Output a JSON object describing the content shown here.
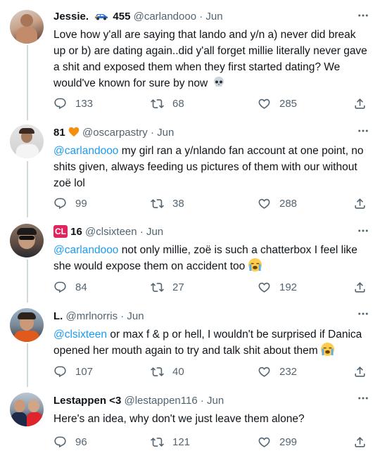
{
  "tweets": [
    {
      "name": "Jessie.",
      "name_suffix": "455",
      "handle": "@carlandooo",
      "date": "Jun",
      "mention": "",
      "text": "Love how y'all are saying that lando and y/n a) never did break up or b) are dating again..did y'all forget millie literally never gave a shit and exposed them when they first started dating? We would've known for sure by now",
      "replies": "133",
      "retweets": "68",
      "likes": "285"
    },
    {
      "name": "81",
      "handle": "@oscarpastry",
      "date": "Jun",
      "mention": "@carlandooo",
      "text": " my girl ran a y/nlando fan account at one point, no shits given, always feeding us pictures of them with our without zoë lol",
      "replies": "99",
      "retweets": "38",
      "likes": "288"
    },
    {
      "name_badge": "CL",
      "name": "16",
      "handle": "@clsixteen",
      "date": "Jun",
      "mention": "@carlandooo",
      "text": " not only millie, zoë is such a chatterbox I feel like she would expose them on accident too",
      "replies": "84",
      "retweets": "27",
      "likes": "192"
    },
    {
      "name": "L.",
      "handle": "@mrlnorris",
      "date": "Jun",
      "mention": "@clsixteen",
      "text": " or max f & p or hell, I wouldn't be surprised if Danica opened her mouth again to try and talk shit about them",
      "replies": "107",
      "retweets": "40",
      "likes": "232"
    },
    {
      "name": "Lestappen <3",
      "handle": "@lestappen116",
      "date": "Jun",
      "mention": "",
      "text": "Here's an idea, why don't we just leave them alone?",
      "replies": "96",
      "retweets": "121",
      "likes": "299"
    }
  ],
  "separator": "·",
  "icons": [
    "reply-icon",
    "retweet-icon",
    "like-icon",
    "share-icon",
    "more-icon"
  ],
  "colors": {
    "link": "#1d9bf0",
    "muted": "#536471",
    "text": "#0f1419",
    "thread": "#cfd9de",
    "badge": "#e0245e",
    "heart_emoji": "#f4900c"
  }
}
